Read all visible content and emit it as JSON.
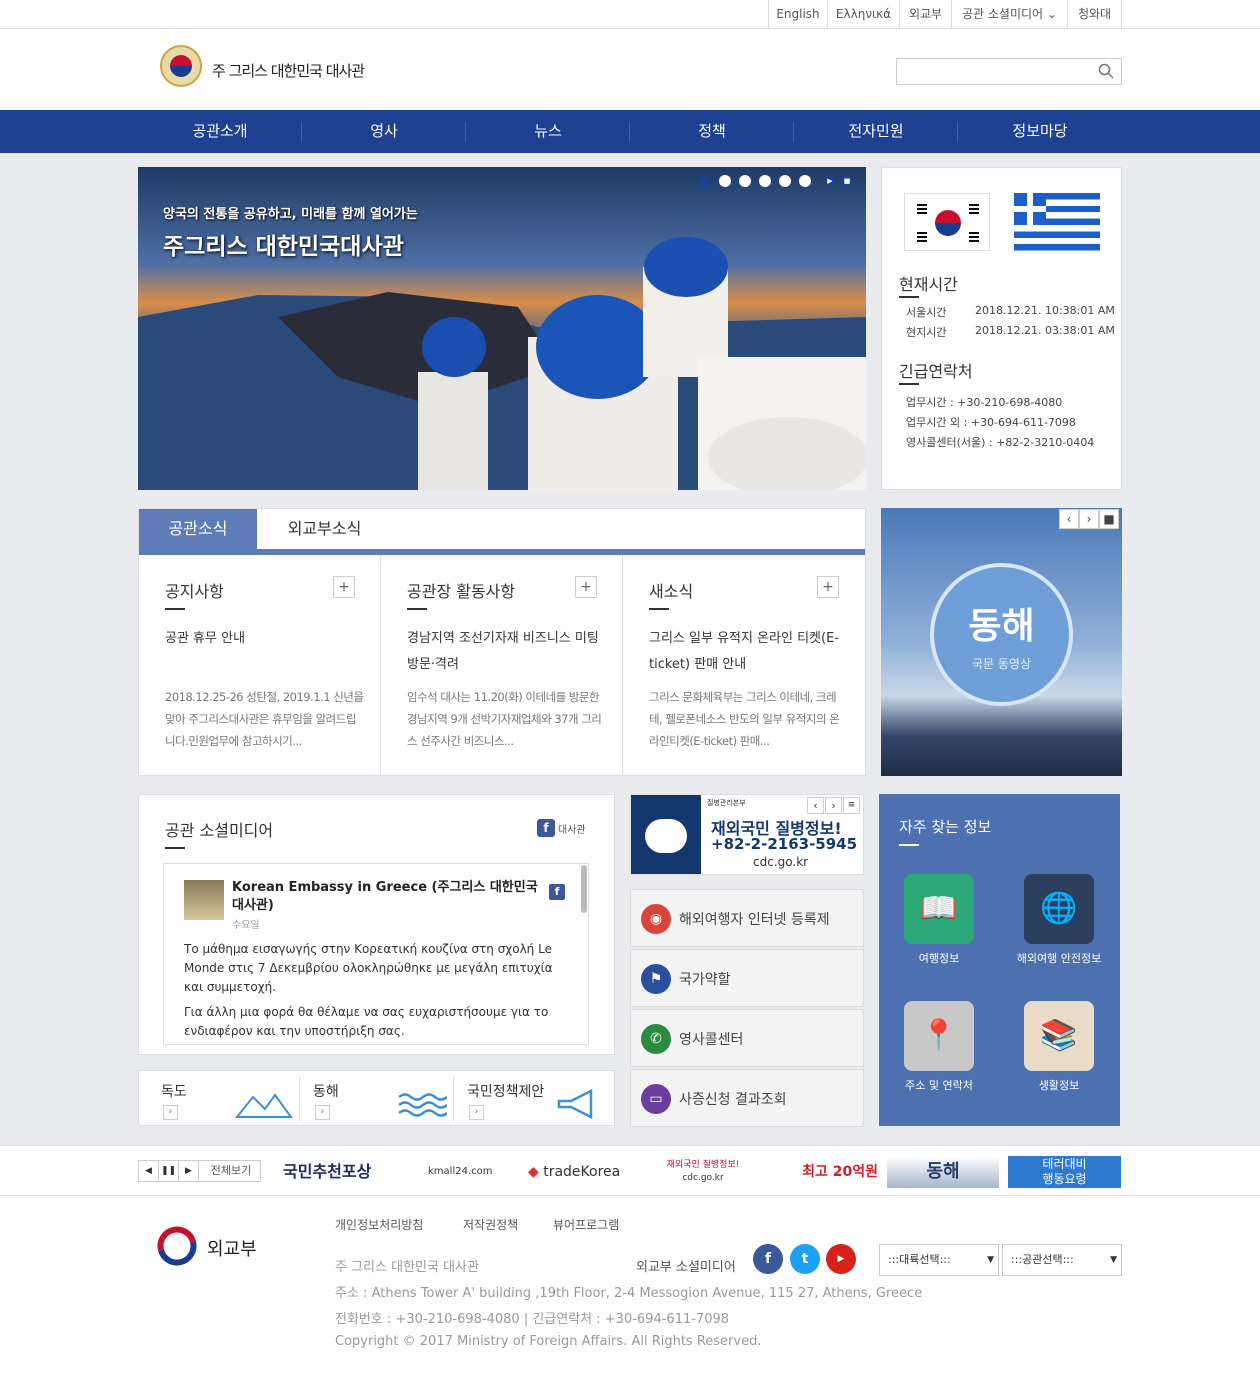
{
  "util": {
    "english": "English",
    "greek": "Ελληνικά",
    "mofa": "외교부",
    "social": "공관 소셜미디어",
    "wa": "청와대"
  },
  "header": {
    "title": "주 그리스 대한민국 대사관"
  },
  "nav": [
    "공관소개",
    "영사",
    "뉴스",
    "정책",
    "전자민원",
    "정보마당"
  ],
  "hero": {
    "subtitle": "양국의 전통을 공유하고, 미래를 함께 열어가는",
    "title": "주그리스 대한민국대사관"
  },
  "info": {
    "time_title": "현재시간",
    "seoul_label": "서울시간",
    "seoul_time": "2018.12.21. 10:38:01 AM",
    "local_label": "현지시간",
    "local_time": "2018.12.21. 03:38:01 AM",
    "contact_title": "긴급연락처",
    "c1": "업무시간 : +30-210-698-4080",
    "c2": "업무시간 외 : +30-694-611-7098",
    "c3": "영사콜센터(서울) : +82-2-3210-0404"
  },
  "tabs": {
    "active": "공관소식",
    "other": "외교부소식"
  },
  "columns": [
    {
      "title": "공지사항",
      "headline": "공관 휴무 안내",
      "body": "2018.12.25-26 성탄절, 2019.1.1 신년을 맞아 주그리스대사관은 휴무임을 알려드립니다.민원업무에 참고하시기..."
    },
    {
      "title": "공관장 활동사항",
      "headline": "경남지역 조선기자재 비즈니스 미팅 방문·격려",
      "body": "임수석 대사는 11.20(화) 이테네를 방문한 경남지역 9개 선박기자재업체와 37개 그리스 선주사간 비즈니스..."
    },
    {
      "title": "새소식",
      "headline": "그리스 일부 유적지 온라인 티켓(E-ticket) 판매 안내",
      "body": "그리스 문화체육부는 그리스 이테네, 크레테, 펠로폰네소스 반도의 일부 유적지의 온라인티켓(E-ticket) 판매..."
    }
  ],
  "donghae": {
    "big": "동해",
    "small": "국문 동영상"
  },
  "social": {
    "title": "공관 소셜미디어",
    "fb_label": "대사관",
    "fb_name": "Korean Embassy in Greece (주그리스 대한민국 대사관)",
    "fb_day": "수요일",
    "fb_p1": "Το μάθημα εισαγωγής στην Κορεατική κουζίνα στη σχολή Le Monde στις 7 Δεκεμβρίου ολοκληρώθηκε με μεγάλη επιτυχία και συμμετοχή.",
    "fb_p2": "Για άλλη μια φορά θα θέλαμε να σας ευχαριστήσουμε για το ενδιαφέρον και την υποστήριξη σας."
  },
  "dokdo": [
    "독도",
    "동해",
    "국민정책제안"
  ],
  "cdc": {
    "org": "질병관리본부",
    "line1": "재외국민 질병정보!",
    "line2": "+82-2-2163-5945",
    "line3": "cdc.go.kr"
  },
  "mid_items": [
    "해외여행자 인터넷 등록제",
    "국가약할",
    "영사콜센터",
    "사증신청 결과조회"
  ],
  "faq": {
    "title": "자주 찾는 정보",
    "items": [
      "여행정보",
      "해외여행 안전정보",
      "주소 및 연락처",
      "생활정보"
    ]
  },
  "banners": {
    "all": "전체보기",
    "b1": "국민추천포상",
    "b2": "kmall24.com",
    "b3": "tradeKorea",
    "b4a": "재외국민 질병정보!",
    "b4b": "cdc.go.kr",
    "b5": "최고 20억원",
    "b6": "동해",
    "b7a": "테러대비",
    "b7b": "행동요령"
  },
  "footer": {
    "logo": "외교부",
    "links": [
      "개인정보처리방침",
      "저작권정책",
      "뷰어프로그램"
    ],
    "embassy": "주 그리스 대한민국 대사관",
    "sns_label": "외교부 소셜미디어",
    "addr": "주소 : Athens Tower A' building ,19th Floor, 2-4 Messogion Avenue, 115 27, Athens, Greece",
    "tel": "전화번호 : +30-210-698-4080 | 긴급연락처 : +30-694-611-7098",
    "copy": "Copyright © 2017 Ministry of Foreign Affairs. All Rights Reserved.",
    "sel1": ":::대륙선택:::",
    "sel2": ":::공관선택:::"
  },
  "colors": {
    "nav": "#1f4192",
    "tab": "#5e7db8",
    "faq": "#4d70b0"
  }
}
